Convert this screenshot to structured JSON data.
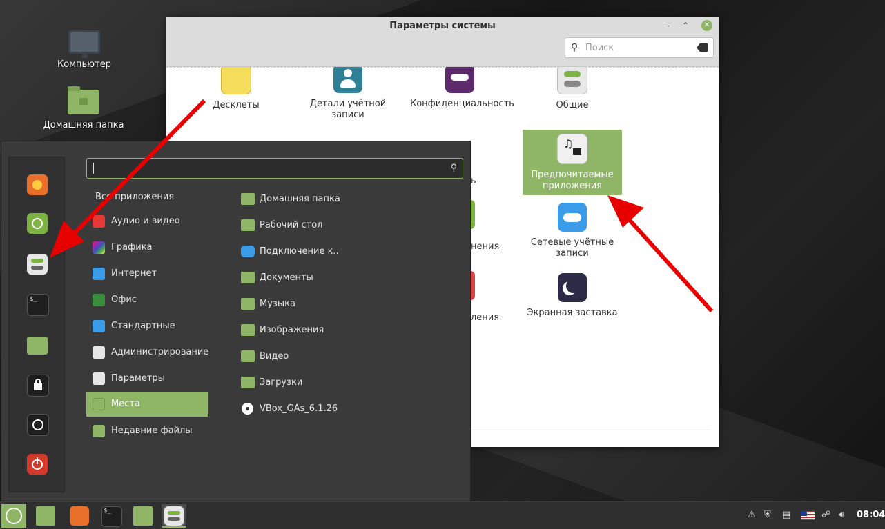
{
  "desktop": {
    "icons": [
      {
        "label": "Компьютер",
        "icon": "computer-icon"
      },
      {
        "label": "Домашняя папка",
        "icon": "home-folder-icon"
      }
    ]
  },
  "settings_window": {
    "title": "Параметры системы",
    "search_placeholder": "Поиск",
    "items": [
      {
        "label": "Десклеты",
        "icon": "desklets-icon",
        "color": "#f3dd5a"
      },
      {
        "label": "Детали учётной записи",
        "icon": "account-details-icon",
        "color": "#2f7f95"
      },
      {
        "label": "Конфиденциальность",
        "icon": "privacy-icon",
        "color": "#5c2a6d"
      },
      {
        "label": "Общие",
        "icon": "general-toggle-icon",
        "color": "#e8e8e8"
      },
      {
        "label": "ь",
        "icon": "partial-icon",
        "color": "#4a90d9"
      },
      {
        "label": "Предпочитаемые приложения",
        "icon": "preferred-apps-icon",
        "color": "#f0f0f0"
      },
      {
        "label": "нения",
        "icon": "partial-icon-2",
        "color": "#7cb342"
      },
      {
        "label": "Сетевые учётные записи",
        "icon": "cloud-icon",
        "color": "#3a9be8"
      },
      {
        "label": "ления",
        "icon": "partial-icon-3",
        "color": "#d64545"
      },
      {
        "label": "Экранная заставка",
        "icon": "screensaver-moon-icon",
        "color": "#2b2b45"
      }
    ]
  },
  "menu": {
    "search_value": "",
    "favorites": [
      {
        "name": "firefox-icon",
        "color": "#e8702a"
      },
      {
        "name": "software-manager-icon",
        "color": "#7cb342"
      },
      {
        "name": "settings-toggle-icon",
        "color": "#e6e6e6"
      },
      {
        "name": "terminal-icon",
        "color": "#1e1e1e"
      },
      {
        "name": "files-folder-icon",
        "color": "#8fb566"
      },
      {
        "name": "lock-icon",
        "color": "#1e1e1e"
      },
      {
        "name": "logout-icon",
        "color": "#1e1e1e"
      },
      {
        "name": "shutdown-icon",
        "color": "#d33a2c"
      }
    ],
    "categories": [
      {
        "label": "Все приложения",
        "icon": "",
        "color": ""
      },
      {
        "label": "Аудио и видео",
        "icon": "audio-video-icon",
        "color": "#e53935"
      },
      {
        "label": "Графика",
        "icon": "graphics-icon",
        "color": "#9c27b0"
      },
      {
        "label": "Интернет",
        "icon": "internet-cloud-icon",
        "color": "#3a9be8"
      },
      {
        "label": "Офис",
        "icon": "office-icon",
        "color": "#388e3c"
      },
      {
        "label": "Стандартные",
        "icon": "accessories-icon",
        "color": "#3a9be8"
      },
      {
        "label": "Администрирование",
        "icon": "administration-icon",
        "color": "#e6e6e6"
      },
      {
        "label": "Параметры",
        "icon": "preferences-icon",
        "color": "#e6e6e6"
      },
      {
        "label": "Места",
        "icon": "places-folder-icon",
        "color": "#8fb566"
      },
      {
        "label": "Недавние файлы",
        "icon": "recent-files-icon",
        "color": "#8fb566"
      }
    ],
    "places": [
      {
        "label": "Домашняя папка",
        "icon": "home-folder-icon"
      },
      {
        "label": "Рабочий стол",
        "icon": "desktop-folder-icon"
      },
      {
        "label": "Подключение к..",
        "icon": "network-cloud-icon"
      },
      {
        "label": "Документы",
        "icon": "documents-folder-icon"
      },
      {
        "label": "Музыка",
        "icon": "music-folder-icon"
      },
      {
        "label": "Изображения",
        "icon": "pictures-folder-icon"
      },
      {
        "label": "Видео",
        "icon": "videos-folder-icon"
      },
      {
        "label": "Загрузки",
        "icon": "downloads-folder-icon"
      },
      {
        "label": "VBox_GAs_6.1.26",
        "icon": "disc-icon"
      }
    ]
  },
  "taskbar": {
    "apps": [
      {
        "name": "menu-button",
        "icon": "mint-logo-icon"
      },
      {
        "name": "show-desktop-button",
        "icon": "desktop-folder-icon"
      },
      {
        "name": "firefox-launcher",
        "icon": "firefox-icon"
      },
      {
        "name": "terminal-launcher",
        "icon": "terminal-icon"
      },
      {
        "name": "files-launcher",
        "icon": "files-folder-icon"
      },
      {
        "name": "settings-window-button",
        "icon": "settings-toggle-icon"
      }
    ],
    "clock": "08:04"
  },
  "accent_color": "#8fb566",
  "annotation_color": "#e60000"
}
